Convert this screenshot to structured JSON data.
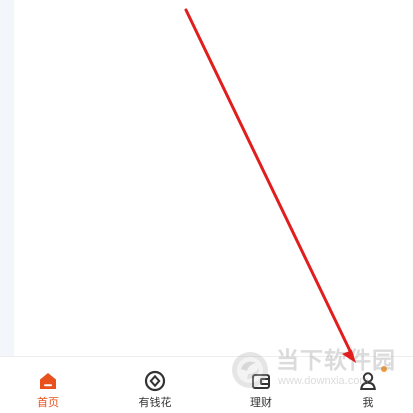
{
  "tabbar": {
    "items": [
      {
        "label": "首页",
        "icon": "home-icon",
        "active": true
      },
      {
        "label": "有钱花",
        "icon": "money-circle-icon",
        "active": false
      },
      {
        "label": "理财",
        "icon": "wallet-icon",
        "active": false
      },
      {
        "label": "我",
        "icon": "user-icon",
        "active": false,
        "badge": true
      }
    ]
  },
  "watermark": {
    "title": "当下软件园",
    "url": "www.downxia.com"
  },
  "colors": {
    "accent": "#e8501e",
    "arrow": "#e11d1d",
    "badge": "#f39a2f",
    "text": "#333333"
  }
}
